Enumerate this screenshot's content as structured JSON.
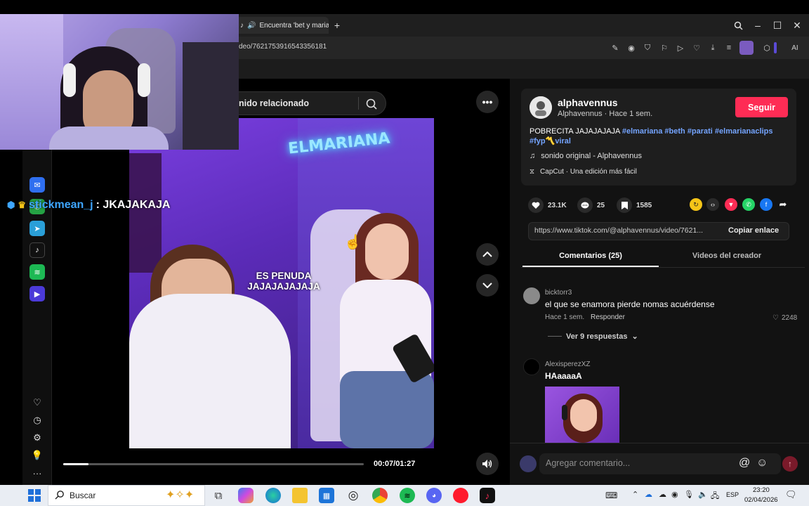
{
  "browser": {
    "tab_title": "Encuentra 'bet y maria",
    "new_tab": "+",
    "url": "deo/7621753916543356181",
    "window": {
      "minimize": "–",
      "maximize": "☐",
      "close": "✕"
    }
  },
  "page": {
    "search_text": "nido relacionado",
    "video_overlay_title": "ELMARIANA",
    "video_caption_line1": "ES PENUDA",
    "video_caption_line2": "JAJAJAJAJAJA",
    "time": "00:07/01:27",
    "progress_fraction": 0.084
  },
  "post": {
    "author_name": "alphavennus",
    "author_meta": "Alphavennus · Hace 1 sem.",
    "follow": "Seguir",
    "caption_text": "POBRECITA JAJAJAJAJA",
    "caption_tags": "#elmariana #beth #parati #elmarianaclips #fyp〽️viral",
    "sound": "sonido original - Alphavennus",
    "capcut": "CapCut · Una edición más fácil",
    "likes": "23.1K",
    "comments": "25",
    "saves": "1585",
    "link": "https://www.tiktok.com/@alphavennus/video/7621...",
    "copy_link": "Copiar enlace",
    "tab_comments": "Comentarios (25)",
    "tab_videos": "Videos del creador"
  },
  "comments": [
    {
      "user": "bicktorr3",
      "text": "el que se enamora pierde nomas acuérdense",
      "time": "Hace 1 sem.",
      "reply": "Responder",
      "likes": "2248",
      "replies": "Ver 9 respuestas"
    },
    {
      "user": "AlexisperezXZ",
      "text": "HAaaaaA"
    }
  ],
  "comment_box": {
    "placeholder": "Agregar comentario..."
  },
  "stream": {
    "chat_user": "stickmean_j",
    "chat_message": ": JKAJAKAJA"
  },
  "taskbar": {
    "search": "Buscar",
    "lang": "ESP",
    "time": "23:20",
    "date": "02/04/2026"
  },
  "colors": {
    "accent": "#fe2c55",
    "hashtag": "#74a4ff",
    "chat_user": "#3ea6ff"
  }
}
